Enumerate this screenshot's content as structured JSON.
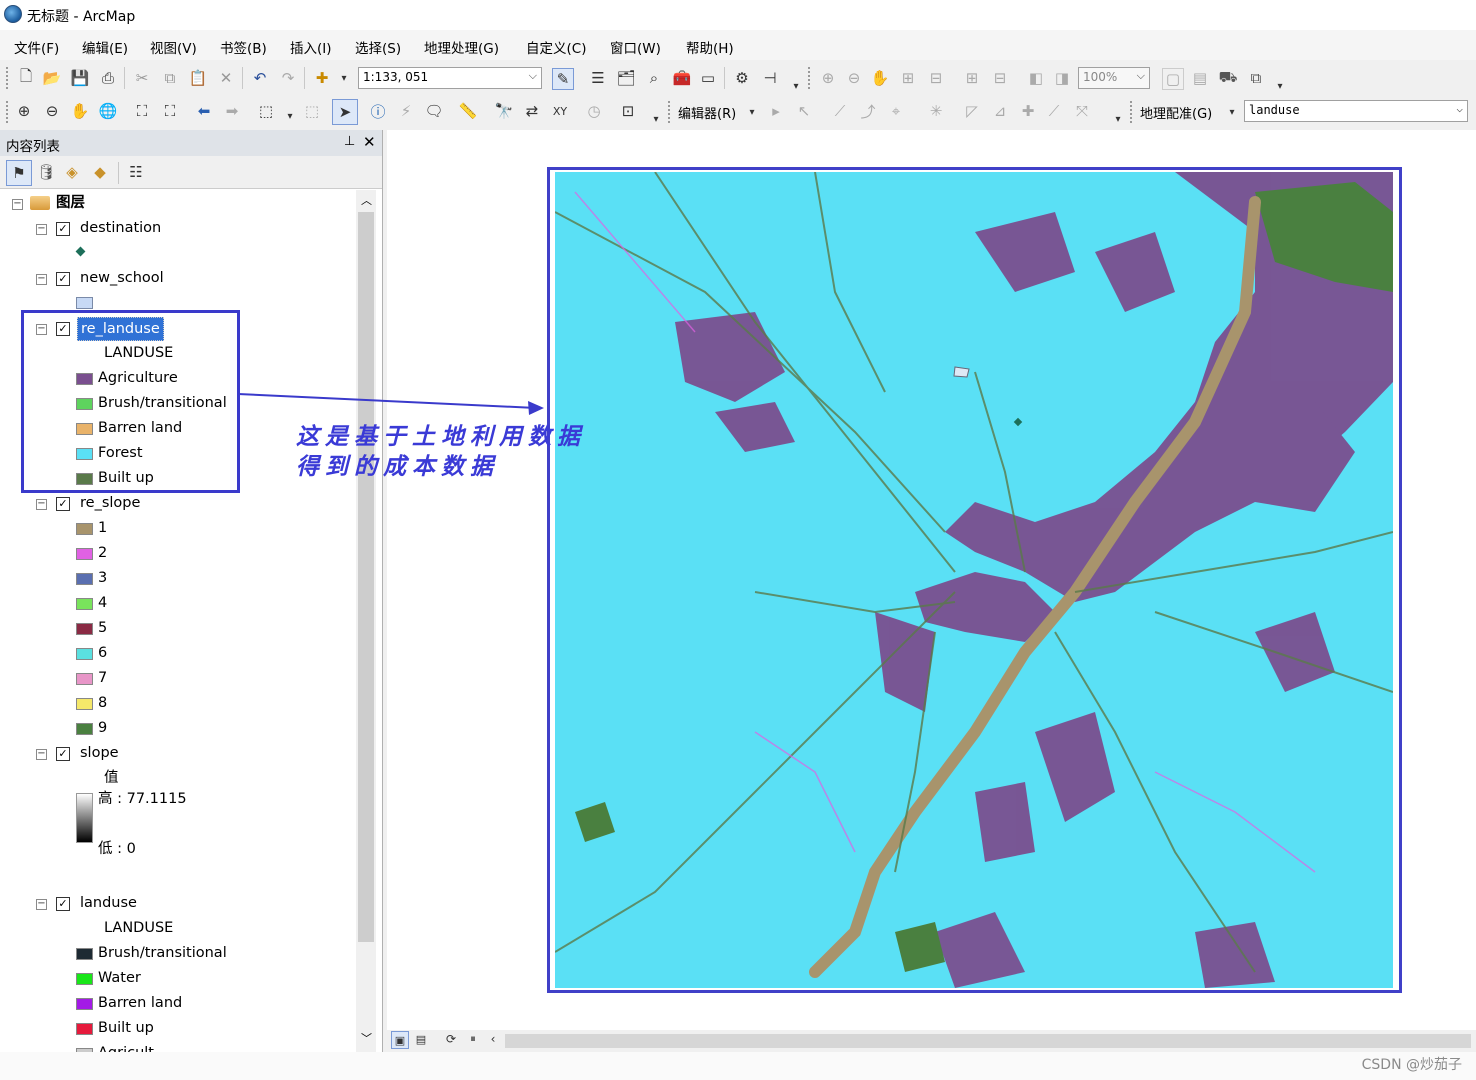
{
  "window": {
    "title": "无标题 - ArcMap"
  },
  "menu": [
    "文件(F)",
    "编辑(E)",
    "视图(V)",
    "书签(B)",
    "插入(I)",
    "选择(S)",
    "地理处理(G)",
    "自定义(C)",
    "窗口(W)",
    "帮助(H)"
  ],
  "toolbar": {
    "scale_value": "1:133, 051",
    "zoom_value": "100%",
    "editor_label": "编辑器(R)",
    "georef_label": "地理配准(G)",
    "georef_layer": "landuse"
  },
  "toc": {
    "title": "内容列表",
    "root_label": "图层",
    "layers": {
      "destination": "destination",
      "new_school": "new_school",
      "re_landuse": {
        "name": "re_landuse",
        "field": "LANDUSE",
        "classes": [
          "Agriculture",
          "Brush/transitional",
          "Barren land",
          "Forest",
          "Built up"
        ],
        "colors": [
          "#7a4f8f",
          "#5ed35e",
          "#e9b36a",
          "#5ae0f5",
          "#5a7a4a"
        ]
      },
      "re_slope": {
        "name": "re_slope",
        "classes": [
          "1",
          "2",
          "3",
          "4",
          "5",
          "6",
          "7",
          "8",
          "9"
        ],
        "colors": [
          "#a8946c",
          "#e061e3",
          "#5a6fb0",
          "#79e35c",
          "#8a2a44",
          "#5ae0e0",
          "#e896c8",
          "#f5e86a",
          "#4a8040"
        ]
      },
      "slope": {
        "name": "slope",
        "field": "值",
        "high": "高 : 77.1115",
        "low": "低 : 0"
      },
      "landuse": {
        "name": "landuse",
        "field": "LANDUSE",
        "classes": [
          "Brush/transitional",
          "Water",
          "Barren land",
          "Built up",
          "Agricult..."
        ],
        "colors": [
          "#1d2a33",
          "#19e619",
          "#a31ae6",
          "#e61a3c",
          "#cccccc"
        ]
      }
    }
  },
  "annotation": {
    "line1": "这是基于土地利用数据",
    "line2": "得到的成本数据"
  },
  "watermark": "CSDN @炒茄子"
}
